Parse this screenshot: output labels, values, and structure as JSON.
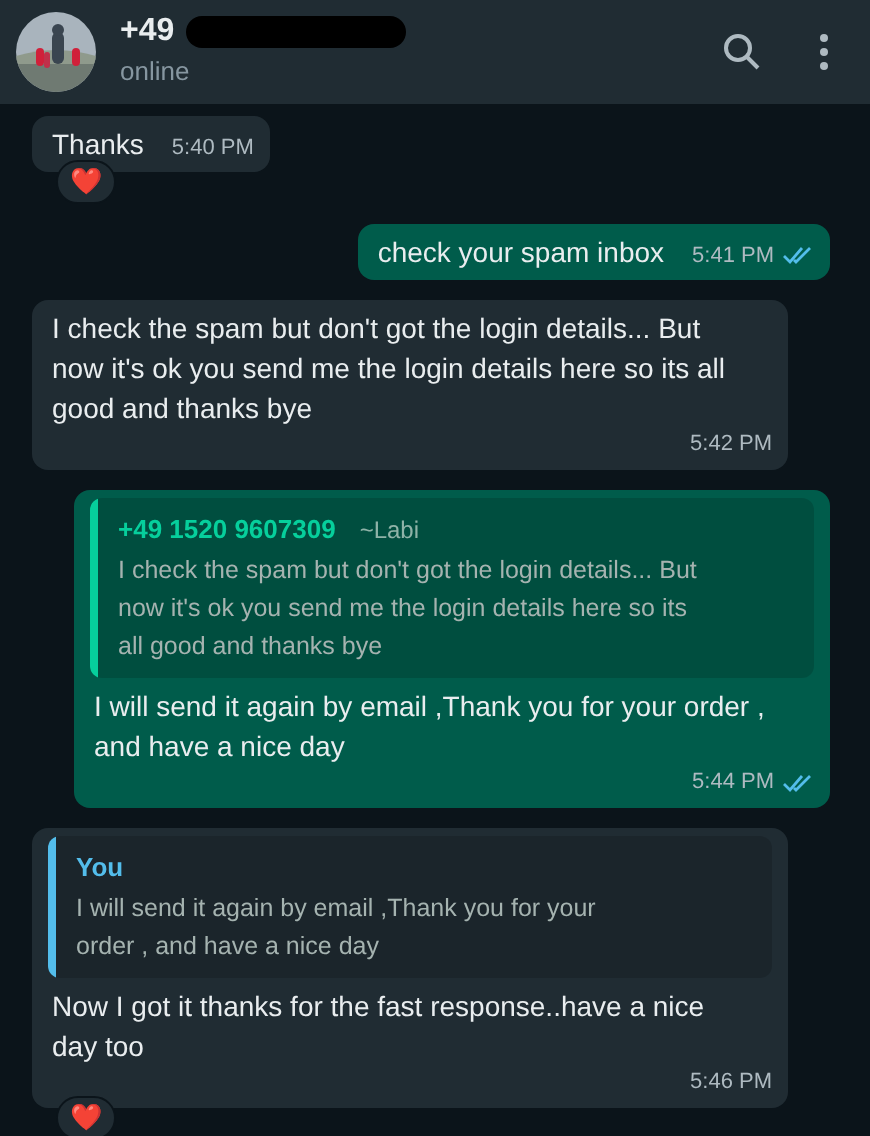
{
  "header": {
    "name": "+49",
    "status": "online",
    "redacted": true
  },
  "messages": [
    {
      "kind": "received",
      "text": "Thanks",
      "time": "5:40 PM",
      "reaction": "❤️"
    },
    {
      "kind": "sent",
      "text": "check your spam inbox",
      "time": "5:41 PM",
      "read": true
    },
    {
      "kind": "received",
      "text": "I check the spam but don't got the login details... But now it's ok you send me the login details here so its all good and thanks bye",
      "time": "5:42 PM"
    },
    {
      "kind": "sent",
      "quote": {
        "author": "+49 1520 9607309",
        "note": "~Labi",
        "text": "I check the spam but don't got the login details... But now it's ok you send me the login details here so its all good and thanks bye",
        "color": "#06cf9c"
      },
      "text": "I will send it again by email ,Thank you for your order , and have a nice day",
      "time": "5:44 PM",
      "read": true
    },
    {
      "kind": "received",
      "quote": {
        "author": "You",
        "text": "I will send it again by email ,Thank you for your order , and have a nice day",
        "color": "#53bdeb"
      },
      "text": "Now I got it thanks for the fast response..have a nice day too",
      "time": "5:46 PM",
      "reaction": "❤️"
    }
  ]
}
